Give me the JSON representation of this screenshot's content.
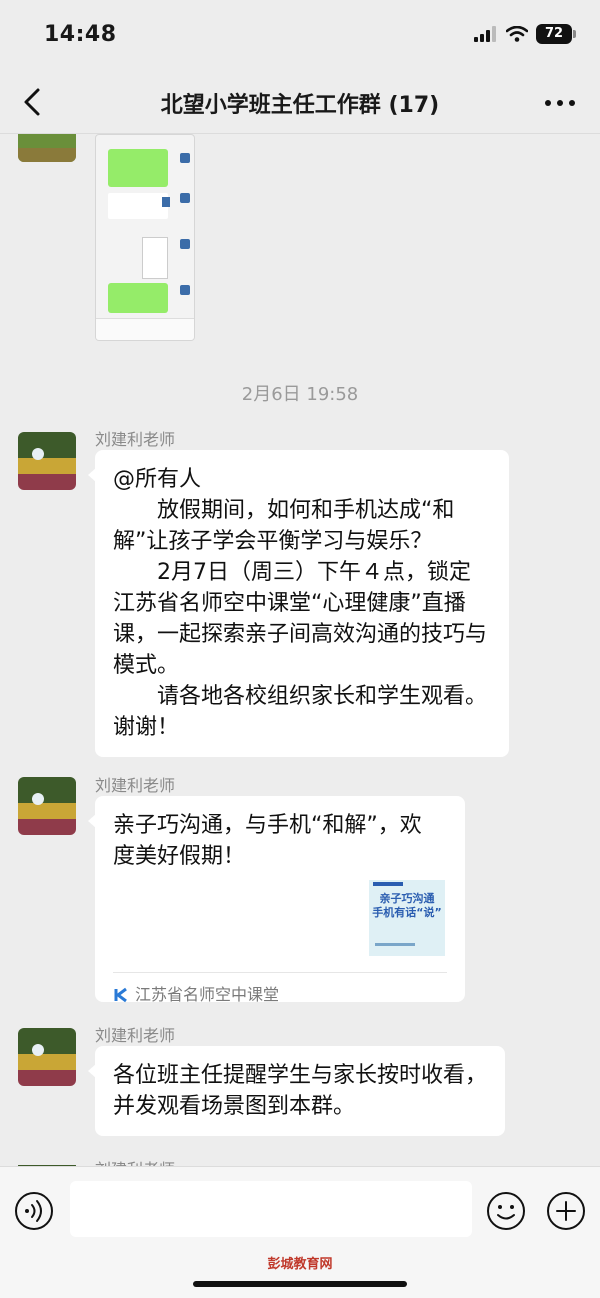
{
  "status": {
    "time": "14:48",
    "battery": "72"
  },
  "nav": {
    "title": "北望小学班主任工作群 (17)"
  },
  "chat": {
    "timestamp": "2月6日 19:58",
    "messages": [
      {
        "sender": "刘建利老师",
        "lines": [
          "@所有人",
          "放假期间，如何和手机达成“和解”让孩子学会平衡学习与娱乐？",
          "2月7日（周三）下午４点，锁定江苏省名师空中课堂“心理健康”直播课，一起探索亲子间高效沟通的技巧与模式。",
          "请各地各校组织家长和学生观看。谢谢！"
        ]
      },
      {
        "sender": "刘建利老师",
        "link_title": "亲子巧沟通，与手机“和解”，欢度美好假期！",
        "link_thumb_text": [
          "亲子巧沟通",
          "手机有话“说”"
        ],
        "link_source": "江苏省名师空中课堂"
      },
      {
        "sender": "刘建利老师",
        "text": "各位班主任提醒学生与家长按时收看，并发观看场景图到本群。"
      },
      {
        "sender": "刘建利老师"
      }
    ]
  },
  "input": {
    "placeholder": ""
  },
  "watermark": "彭城教育网",
  "colors": {
    "background": "#ededed",
    "bubble": "#ffffff",
    "accent_green": "#95ec69"
  },
  "icons": [
    "back-icon",
    "more-icon",
    "voice-icon",
    "emoji-icon",
    "plus-icon",
    "link-source-icon"
  ]
}
